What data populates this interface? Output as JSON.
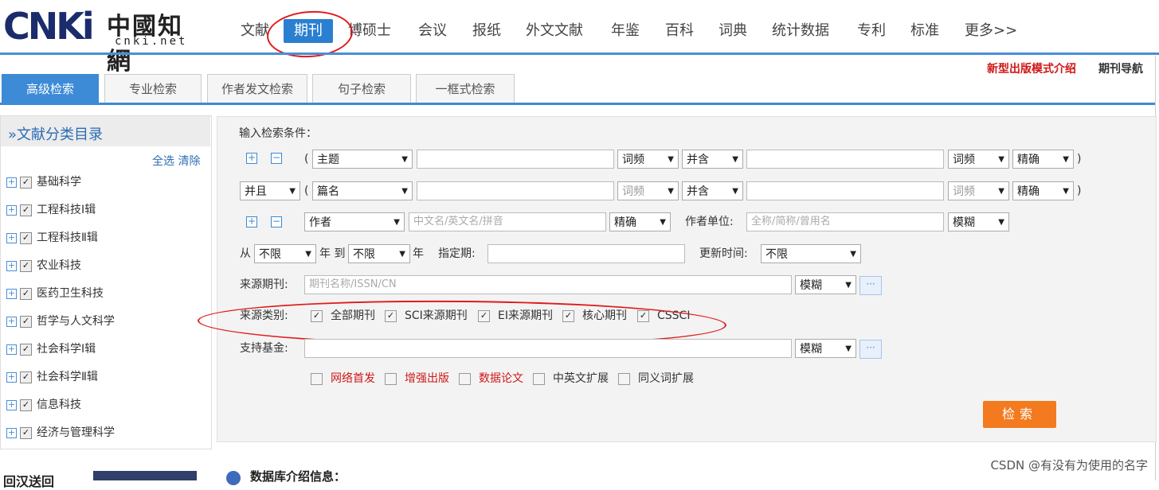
{
  "header": {
    "logo_text": "CNKi",
    "logo_cn": "中國知網",
    "logo_url": "cnki.net",
    "nav": [
      "文献",
      "期刊",
      "博硕士",
      "会议",
      "报纸",
      "外文文献",
      "年鉴",
      "百科",
      "词典",
      "统计数据",
      "专利",
      "标准",
      "更多>>"
    ],
    "active_nav": "期刊"
  },
  "top_links": {
    "new_mode": "新型出版模式介绍",
    "journal_nav": "期刊导航"
  },
  "tabs": [
    "高级检索",
    "专业检索",
    "作者发文检索",
    "句子检索",
    "一框式检索"
  ],
  "sidebar": {
    "title": "»文献分类目录",
    "select_all": "全选",
    "clear": "清除",
    "plus": "+",
    "check": "✓",
    "items": [
      "基础科学",
      "工程科技Ⅰ辑",
      "工程科技Ⅱ辑",
      "农业科技",
      "医药卫生科技",
      "哲学与人文科学",
      "社会科学Ⅰ辑",
      "社会科学Ⅱ辑",
      "信息科技",
      "经济与管理科学"
    ]
  },
  "form": {
    "heading": "输入检索条件：",
    "row1": {
      "paren_open": "(",
      "field": "主题",
      "freq1": "词频",
      "combine": "并含",
      "freq2": "词频",
      "match": "精确",
      "paren_close": ")"
    },
    "row2": {
      "logic": "并且",
      "paren_open": "(",
      "field": "篇名",
      "freq1": "词频",
      "combine": "并含",
      "freq2": "词频",
      "match": "精确",
      "paren_close": ")"
    },
    "row3": {
      "field": "作者",
      "author_placeholder": "中文名/英文名/拼音",
      "match": "精确",
      "unit_label": "作者单位:",
      "unit_placeholder": "全称/简称/曾用名",
      "unit_match": "模糊"
    },
    "row4": {
      "from": "从",
      "from_val": "不限",
      "year_to": "年 到",
      "to_val": "不限",
      "year": "年",
      "period_label": "指定期:",
      "update_label": "更新时间:",
      "update_val": "不限"
    },
    "row5": {
      "label": "来源期刊:",
      "placeholder": "期刊名称/ISSN/CN",
      "match": "模糊",
      "dots": "···"
    },
    "row6": {
      "label": "来源类别:",
      "options": [
        "全部期刊",
        "SCI来源期刊",
        "EI来源期刊",
        "核心期刊",
        "CSSCI"
      ]
    },
    "row7": {
      "label": "支持基金:",
      "match": "模糊",
      "dots": "···"
    },
    "row8": {
      "options": [
        "网络首发",
        "增强出版",
        "数据论文",
        "中英文扩展",
        "同义词扩展"
      ]
    },
    "plus": "+",
    "minus": "−",
    "arrow": "▼",
    "check": "✓",
    "search_button": "检索"
  },
  "bottom": {
    "qr_text": "回汉送回",
    "db_info": "数据库介绍信息："
  },
  "watermark": "CSDN @有没有为使用的名字",
  "colors": {
    "brand_blue": "#2a7fd0",
    "tab_blue": "#3d8ad6",
    "search_orange": "#f37a1f",
    "annotation_red": "#e01b1b",
    "link_red": "#d01818"
  }
}
